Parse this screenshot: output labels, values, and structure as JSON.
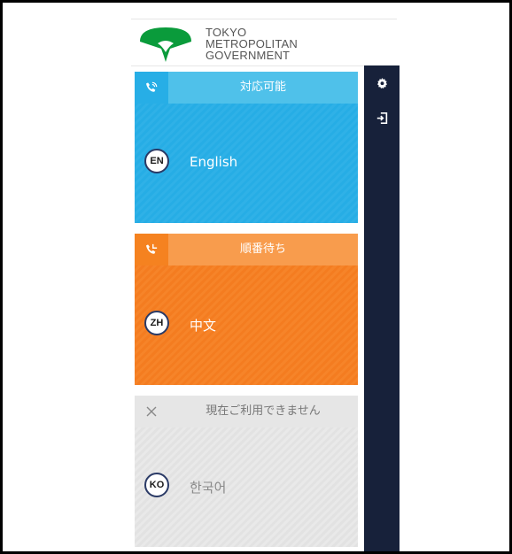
{
  "logo": {
    "line1": "TOKYO",
    "line2": "METROPOLITAN",
    "line3": "GOVERNMENT",
    "brand_color": "#0a9b3b"
  },
  "sidebar": {
    "items": [
      {
        "icon": "gear-icon"
      },
      {
        "icon": "sign-in-icon"
      }
    ],
    "background": "#17213a"
  },
  "languages": [
    {
      "status_label": "対応可能",
      "status_icon": "phone-in-talk-icon",
      "code": "EN",
      "name": "English",
      "color": "#26ade5"
    },
    {
      "status_label": "順番待ち",
      "status_icon": "phone-waiting-icon",
      "code": "ZH",
      "name": "中文",
      "color": "#f47c20"
    },
    {
      "status_label": "現在ご利用できません",
      "status_icon": "close-icon",
      "code": "KO",
      "name": "한국어",
      "color": "#e6e6e6"
    }
  ]
}
